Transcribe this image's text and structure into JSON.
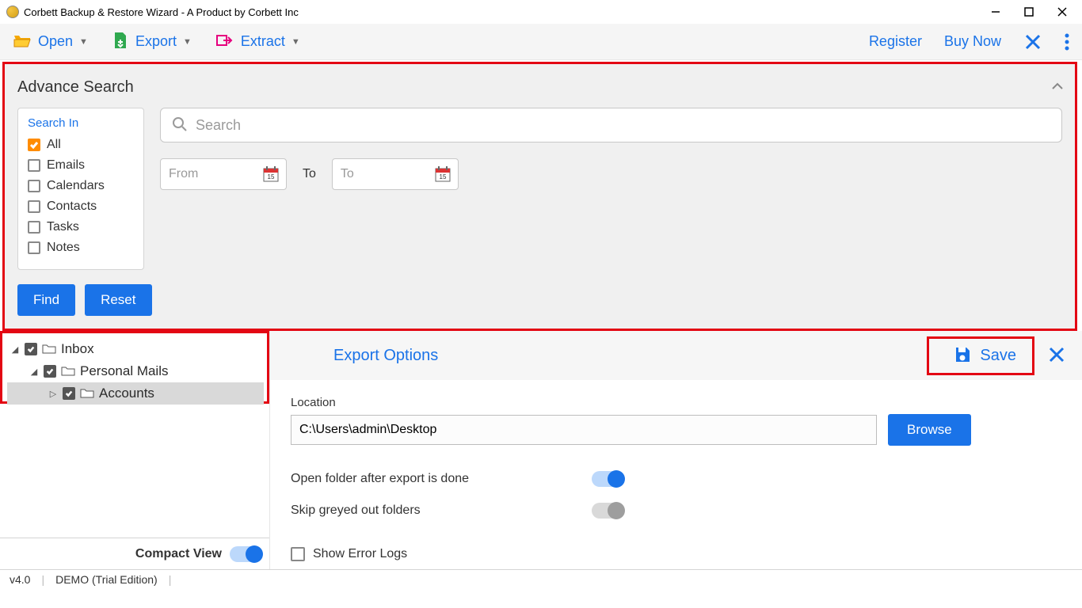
{
  "window": {
    "title": "Corbett Backup & Restore Wizard - A Product by Corbett Inc"
  },
  "toolbar": {
    "open": "Open",
    "export": "Export",
    "extract": "Extract",
    "register": "Register",
    "buy_now": "Buy Now"
  },
  "advance_search": {
    "title": "Advance Search",
    "search_in_label": "Search In",
    "items": [
      {
        "label": "All",
        "checked": true
      },
      {
        "label": "Emails",
        "checked": false
      },
      {
        "label": "Calendars",
        "checked": false
      },
      {
        "label": "Contacts",
        "checked": false
      },
      {
        "label": "Tasks",
        "checked": false
      },
      {
        "label": "Notes",
        "checked": false
      }
    ],
    "search_placeholder": "Search",
    "from_placeholder": "From",
    "to_label": "To",
    "to_placeholder": "To",
    "find_button": "Find",
    "reset_button": "Reset"
  },
  "tree": {
    "nodes": [
      {
        "label": "Inbox",
        "level": 1,
        "expanded": true,
        "checked": true,
        "selected": false
      },
      {
        "label": "Personal Mails",
        "level": 2,
        "expanded": true,
        "checked": true,
        "selected": false
      },
      {
        "label": "Accounts",
        "level": 3,
        "expanded": false,
        "checked": true,
        "selected": true
      }
    ],
    "compact_view": "Compact View",
    "compact_on": true
  },
  "export": {
    "title": "Export Options",
    "save": "Save",
    "location_label": "Location",
    "location_value": "C:\\Users\\admin\\Desktop",
    "browse": "Browse",
    "open_folder": "Open folder after export is done",
    "open_folder_on": true,
    "skip_greyed": "Skip greyed out folders",
    "skip_greyed_on": false,
    "show_errors": "Show Error Logs",
    "show_errors_checked": false
  },
  "status": {
    "version": "v4.0",
    "edition": "DEMO (Trial Edition)"
  }
}
